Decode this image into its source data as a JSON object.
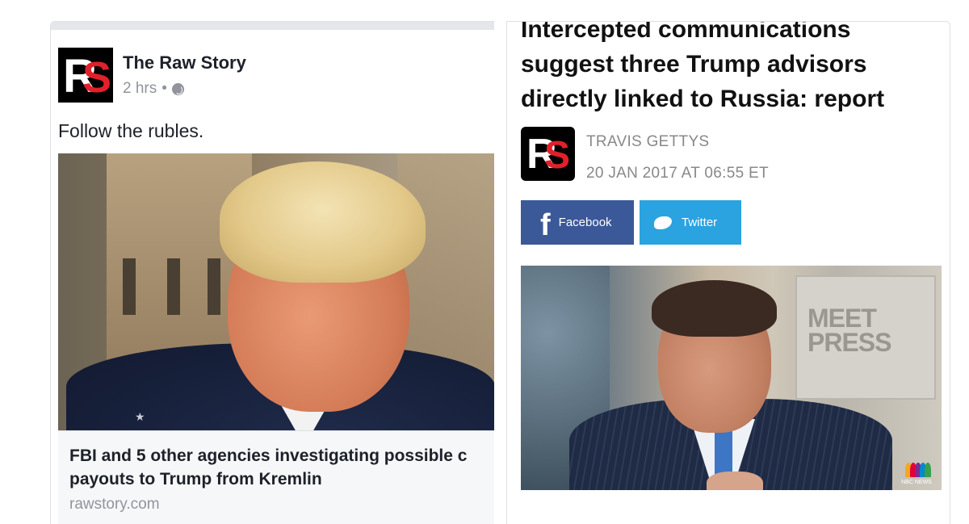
{
  "left_post": {
    "logo_r": "R",
    "logo_s": "S",
    "page_name": "The Raw Story",
    "time": "2 hrs",
    "separator": "•",
    "caption": "Follow the rubles.",
    "link_title_line1": "FBI and 5 other agencies investigating possible c",
    "link_title_line2": "payouts to Trump from Kremlin",
    "link_domain": "rawstory.com"
  },
  "right_article": {
    "headline": "Intercepted communications suggest three Trump advisors directly linked to Russia: report",
    "logo_r": "R",
    "logo_s": "S",
    "author": "TRAVIS GETTYS",
    "date": "20 JAN 2017 AT 06:55 ET",
    "share": {
      "facebook_label": "Facebook",
      "twitter_label": "Twitter",
      "facebook_glyph": "f"
    },
    "photo": {
      "backdrop_text_1": "MEET",
      "backdrop_text_2": "PRESS",
      "network_logo": "NBC NEWS"
    }
  },
  "colors": {
    "facebook_blue": "#3b5998",
    "twitter_blue": "#2aa3e0",
    "logo_red": "#e0202a",
    "meta_gray": "#90949c"
  }
}
